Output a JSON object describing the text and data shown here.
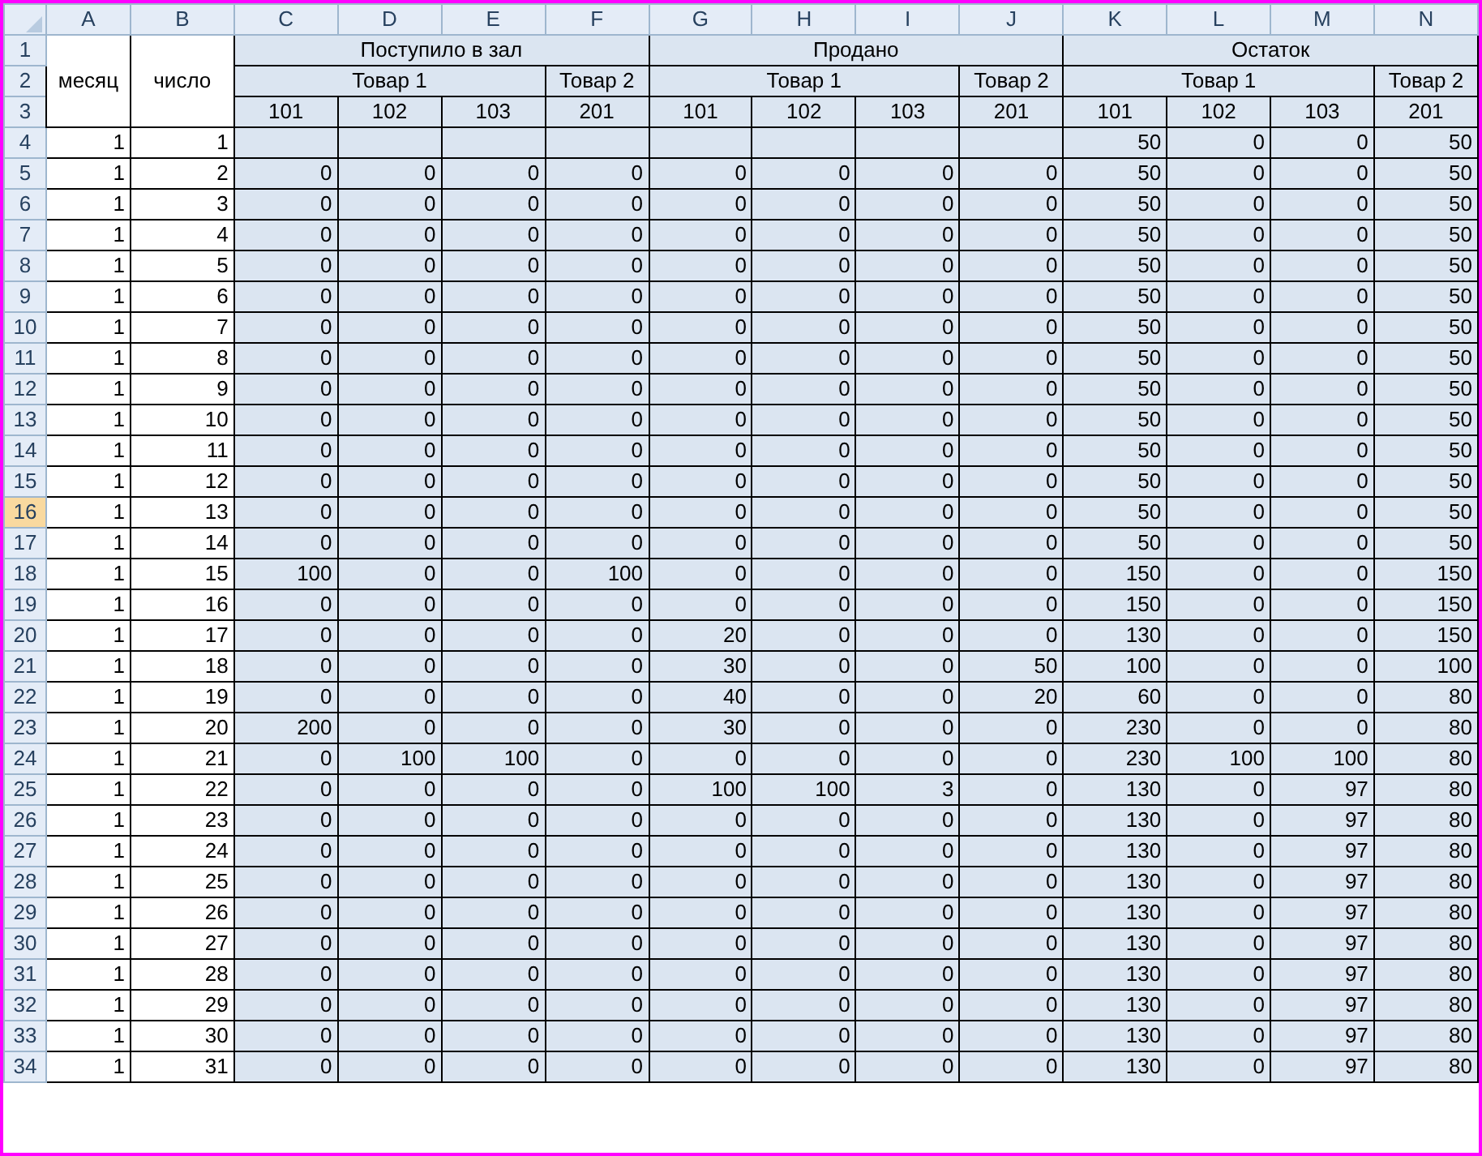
{
  "columns": [
    "A",
    "B",
    "C",
    "D",
    "E",
    "F",
    "G",
    "H",
    "I",
    "J",
    "K",
    "L",
    "M",
    "N"
  ],
  "header": {
    "row_labels": [
      "1",
      "2",
      "3"
    ],
    "month_label": "месяц",
    "day_label": "число",
    "groups": [
      {
        "title": "Поступило в зал",
        "products": [
          {
            "name": "Товар 1",
            "codes": [
              "101",
              "102",
              "103"
            ]
          },
          {
            "name": "Товар 2",
            "codes": [
              "201"
            ]
          }
        ]
      },
      {
        "title": "Продано",
        "products": [
          {
            "name": "Товар 1",
            "codes": [
              "101",
              "102",
              "103"
            ]
          },
          {
            "name": "Товар 2",
            "codes": [
              "201"
            ]
          }
        ]
      },
      {
        "title": "Остаток",
        "products": [
          {
            "name": "Товар 1",
            "codes": [
              "101",
              "102",
              "103"
            ]
          },
          {
            "name": "Товар 2",
            "codes": [
              "201"
            ]
          }
        ]
      }
    ]
  },
  "rows": [
    {
      "n": "4",
      "selected": false,
      "month": "1",
      "day": "1",
      "stock": [
        "50",
        "0",
        "0",
        "50"
      ]
    },
    {
      "n": "5",
      "selected": false,
      "month": "1",
      "day": "2",
      "received": [
        "0",
        "0",
        "0",
        "0"
      ],
      "sold": [
        "0",
        "0",
        "0",
        "0"
      ],
      "stock": [
        "50",
        "0",
        "0",
        "50"
      ]
    },
    {
      "n": "6",
      "selected": false,
      "month": "1",
      "day": "3",
      "received": [
        "0",
        "0",
        "0",
        "0"
      ],
      "sold": [
        "0",
        "0",
        "0",
        "0"
      ],
      "stock": [
        "50",
        "0",
        "0",
        "50"
      ]
    },
    {
      "n": "7",
      "selected": false,
      "month": "1",
      "day": "4",
      "received": [
        "0",
        "0",
        "0",
        "0"
      ],
      "sold": [
        "0",
        "0",
        "0",
        "0"
      ],
      "stock": [
        "50",
        "0",
        "0",
        "50"
      ]
    },
    {
      "n": "8",
      "selected": false,
      "month": "1",
      "day": "5",
      "received": [
        "0",
        "0",
        "0",
        "0"
      ],
      "sold": [
        "0",
        "0",
        "0",
        "0"
      ],
      "stock": [
        "50",
        "0",
        "0",
        "50"
      ]
    },
    {
      "n": "9",
      "selected": false,
      "month": "1",
      "day": "6",
      "received": [
        "0",
        "0",
        "0",
        "0"
      ],
      "sold": [
        "0",
        "0",
        "0",
        "0"
      ],
      "stock": [
        "50",
        "0",
        "0",
        "50"
      ]
    },
    {
      "n": "10",
      "selected": false,
      "month": "1",
      "day": "7",
      "received": [
        "0",
        "0",
        "0",
        "0"
      ],
      "sold": [
        "0",
        "0",
        "0",
        "0"
      ],
      "stock": [
        "50",
        "0",
        "0",
        "50"
      ]
    },
    {
      "n": "11",
      "selected": false,
      "month": "1",
      "day": "8",
      "received": [
        "0",
        "0",
        "0",
        "0"
      ],
      "sold": [
        "0",
        "0",
        "0",
        "0"
      ],
      "stock": [
        "50",
        "0",
        "0",
        "50"
      ]
    },
    {
      "n": "12",
      "selected": false,
      "month": "1",
      "day": "9",
      "received": [
        "0",
        "0",
        "0",
        "0"
      ],
      "sold": [
        "0",
        "0",
        "0",
        "0"
      ],
      "stock": [
        "50",
        "0",
        "0",
        "50"
      ]
    },
    {
      "n": "13",
      "selected": false,
      "month": "1",
      "day": "10",
      "received": [
        "0",
        "0",
        "0",
        "0"
      ],
      "sold": [
        "0",
        "0",
        "0",
        "0"
      ],
      "stock": [
        "50",
        "0",
        "0",
        "50"
      ]
    },
    {
      "n": "14",
      "selected": false,
      "month": "1",
      "day": "11",
      "received": [
        "0",
        "0",
        "0",
        "0"
      ],
      "sold": [
        "0",
        "0",
        "0",
        "0"
      ],
      "stock": [
        "50",
        "0",
        "0",
        "50"
      ]
    },
    {
      "n": "15",
      "selected": false,
      "month": "1",
      "day": "12",
      "received": [
        "0",
        "0",
        "0",
        "0"
      ],
      "sold": [
        "0",
        "0",
        "0",
        "0"
      ],
      "stock": [
        "50",
        "0",
        "0",
        "50"
      ]
    },
    {
      "n": "16",
      "selected": true,
      "month": "1",
      "day": "13",
      "received": [
        "0",
        "0",
        "0",
        "0"
      ],
      "sold": [
        "0",
        "0",
        "0",
        "0"
      ],
      "stock": [
        "50",
        "0",
        "0",
        "50"
      ]
    },
    {
      "n": "17",
      "selected": false,
      "month": "1",
      "day": "14",
      "received": [
        "0",
        "0",
        "0",
        "0"
      ],
      "sold": [
        "0",
        "0",
        "0",
        "0"
      ],
      "stock": [
        "50",
        "0",
        "0",
        "50"
      ]
    },
    {
      "n": "18",
      "selected": false,
      "month": "1",
      "day": "15",
      "received": [
        "100",
        "0",
        "0",
        "100"
      ],
      "sold": [
        "0",
        "0",
        "0",
        "0"
      ],
      "stock": [
        "150",
        "0",
        "0",
        "150"
      ]
    },
    {
      "n": "19",
      "selected": false,
      "month": "1",
      "day": "16",
      "received": [
        "0",
        "0",
        "0",
        "0"
      ],
      "sold": [
        "0",
        "0",
        "0",
        "0"
      ],
      "stock": [
        "150",
        "0",
        "0",
        "150"
      ]
    },
    {
      "n": "20",
      "selected": false,
      "month": "1",
      "day": "17",
      "received": [
        "0",
        "0",
        "0",
        "0"
      ],
      "sold": [
        "20",
        "0",
        "0",
        "0"
      ],
      "stock": [
        "130",
        "0",
        "0",
        "150"
      ]
    },
    {
      "n": "21",
      "selected": false,
      "month": "1",
      "day": "18",
      "received": [
        "0",
        "0",
        "0",
        "0"
      ],
      "sold": [
        "30",
        "0",
        "0",
        "50"
      ],
      "stock": [
        "100",
        "0",
        "0",
        "100"
      ]
    },
    {
      "n": "22",
      "selected": false,
      "month": "1",
      "day": "19",
      "received": [
        "0",
        "0",
        "0",
        "0"
      ],
      "sold": [
        "40",
        "0",
        "0",
        "20"
      ],
      "stock": [
        "60",
        "0",
        "0",
        "80"
      ]
    },
    {
      "n": "23",
      "selected": false,
      "month": "1",
      "day": "20",
      "received": [
        "200",
        "0",
        "0",
        "0"
      ],
      "sold": [
        "30",
        "0",
        "0",
        "0"
      ],
      "stock": [
        "230",
        "0",
        "0",
        "80"
      ]
    },
    {
      "n": "24",
      "selected": false,
      "month": "1",
      "day": "21",
      "received": [
        "0",
        "100",
        "100",
        "0"
      ],
      "sold": [
        "0",
        "0",
        "0",
        "0"
      ],
      "stock": [
        "230",
        "100",
        "100",
        "80"
      ]
    },
    {
      "n": "25",
      "selected": false,
      "month": "1",
      "day": "22",
      "received": [
        "0",
        "0",
        "0",
        "0"
      ],
      "sold": [
        "100",
        "100",
        "3",
        "0"
      ],
      "stock": [
        "130",
        "0",
        "97",
        "80"
      ]
    },
    {
      "n": "26",
      "selected": false,
      "month": "1",
      "day": "23",
      "received": [
        "0",
        "0",
        "0",
        "0"
      ],
      "sold": [
        "0",
        "0",
        "0",
        "0"
      ],
      "stock": [
        "130",
        "0",
        "97",
        "80"
      ]
    },
    {
      "n": "27",
      "selected": false,
      "month": "1",
      "day": "24",
      "received": [
        "0",
        "0",
        "0",
        "0"
      ],
      "sold": [
        "0",
        "0",
        "0",
        "0"
      ],
      "stock": [
        "130",
        "0",
        "97",
        "80"
      ]
    },
    {
      "n": "28",
      "selected": false,
      "month": "1",
      "day": "25",
      "received": [
        "0",
        "0",
        "0",
        "0"
      ],
      "sold": [
        "0",
        "0",
        "0",
        "0"
      ],
      "stock": [
        "130",
        "0",
        "97",
        "80"
      ]
    },
    {
      "n": "29",
      "selected": false,
      "month": "1",
      "day": "26",
      "received": [
        "0",
        "0",
        "0",
        "0"
      ],
      "sold": [
        "0",
        "0",
        "0",
        "0"
      ],
      "stock": [
        "130",
        "0",
        "97",
        "80"
      ]
    },
    {
      "n": "30",
      "selected": false,
      "month": "1",
      "day": "27",
      "received": [
        "0",
        "0",
        "0",
        "0"
      ],
      "sold": [
        "0",
        "0",
        "0",
        "0"
      ],
      "stock": [
        "130",
        "0",
        "97",
        "80"
      ]
    },
    {
      "n": "31",
      "selected": false,
      "month": "1",
      "day": "28",
      "received": [
        "0",
        "0",
        "0",
        "0"
      ],
      "sold": [
        "0",
        "0",
        "0",
        "0"
      ],
      "stock": [
        "130",
        "0",
        "97",
        "80"
      ]
    },
    {
      "n": "32",
      "selected": false,
      "month": "1",
      "day": "29",
      "received": [
        "0",
        "0",
        "0",
        "0"
      ],
      "sold": [
        "0",
        "0",
        "0",
        "0"
      ],
      "stock": [
        "130",
        "0",
        "97",
        "80"
      ]
    },
    {
      "n": "33",
      "selected": false,
      "month": "1",
      "day": "30",
      "received": [
        "0",
        "0",
        "0",
        "0"
      ],
      "sold": [
        "0",
        "0",
        "0",
        "0"
      ],
      "stock": [
        "130",
        "0",
        "97",
        "80"
      ]
    },
    {
      "n": "34",
      "selected": false,
      "month": "1",
      "day": "31",
      "received": [
        "0",
        "0",
        "0",
        "0"
      ],
      "sold": [
        "0",
        "0",
        "0",
        "0"
      ],
      "stock": [
        "130",
        "0",
        "97",
        "80"
      ]
    }
  ]
}
